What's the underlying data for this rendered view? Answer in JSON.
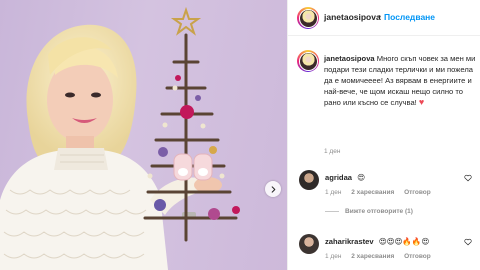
{
  "post": {
    "username": "janetaosipova",
    "follow_label": "Последване",
    "separator": "•",
    "caption": "Много скъп човек за мен ми подари тези сладки терлички и ми пожела да е момичееее! Аз вярвам в енергиите и най-вече, че щом искаш нещо силно то рано или късно се случва!",
    "caption_emoji": "♥",
    "caption_age": "1 ден"
  },
  "comments": [
    {
      "username": "agridaa",
      "text": "😍",
      "age": "1 ден",
      "likes": "2 харесвания",
      "reply_label": "Отговор",
      "replies_label": "Вижте отговорите (1)"
    },
    {
      "username": "zaharikrastev",
      "text": "😍😍😍🔥🔥😍",
      "age": "1 ден",
      "likes": "2 харесвания",
      "reply_label": "Отговор"
    }
  ],
  "icons": {
    "carousel_next": "chevron-right-icon",
    "like": "heart-outline-icon"
  },
  "colors": {
    "link_blue": "#0095f6",
    "secondary_text": "#8e8e8e",
    "heart_red": "#ed4956"
  }
}
